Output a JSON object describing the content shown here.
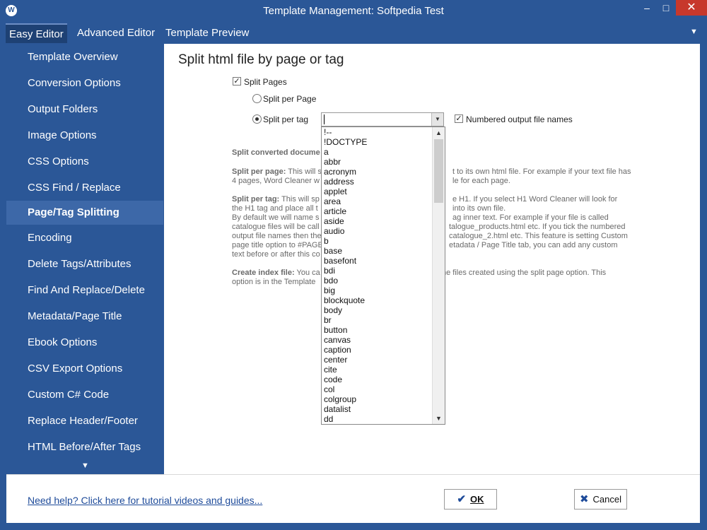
{
  "window": {
    "title": "Template Management: Softpedia Test",
    "app_icon": "W",
    "minimize_label": "–",
    "maximize_label": "□",
    "close_label": "✕"
  },
  "tabs": [
    {
      "label": "Easy Editor",
      "active": true
    },
    {
      "label": "Advanced Editor",
      "active": false
    },
    {
      "label": "Template Preview",
      "active": false
    }
  ],
  "tab_menu_arrow": "▼",
  "sidebar": {
    "items": [
      {
        "label": "Template Overview"
      },
      {
        "label": "Conversion Options"
      },
      {
        "label": "Output Folders"
      },
      {
        "label": "Image Options"
      },
      {
        "label": "CSS Options"
      },
      {
        "label": "CSS Find / Replace"
      },
      {
        "label": "Page/Tag Splitting",
        "selected": true
      },
      {
        "label": "Encoding"
      },
      {
        "label": "Delete Tags/Attributes"
      },
      {
        "label": "Find And Replace/Delete"
      },
      {
        "label": "Metadata/Page Title"
      },
      {
        "label": "Ebook Options"
      },
      {
        "label": "CSV Export Options"
      },
      {
        "label": "Custom C# Code"
      },
      {
        "label": "Replace Header/Footer"
      },
      {
        "label": "HTML Before/After Tags"
      }
    ],
    "scroll_down": "▼"
  },
  "main": {
    "title": "Split html file by page or tag",
    "split_pages": {
      "label": "Split Pages",
      "checked": true,
      "mark": "✓"
    },
    "split_per_page": {
      "label": "Split per Page",
      "selected": false
    },
    "split_per_tag": {
      "label": "Split per tag",
      "selected": true
    },
    "tag_combo_value": "",
    "combo_arrow": "▼",
    "numbered_names": {
      "label": "Numbered output file names",
      "checked": true,
      "mark": "✓"
    },
    "desc": {
      "heading": "Split converted docume",
      "per_page_bold": "Split per page:",
      "per_page_1a": " This will s",
      "per_page_1b": "t to its own html file. For example if your text file has",
      "per_page_2a": "4 pages, Word Cleaner w",
      "per_page_2b": "le for each page.",
      "per_tag_bold": "Split per tag:",
      "per_tag_1a": " This will sp",
      "per_tag_1b": "e H1. If you select H1 Word Cleaner will look for",
      "per_tag_2a": "the H1 tag and place all t",
      "per_tag_2b": "into its own file.",
      "per_tag_3a": "By default we will name s",
      "per_tag_3b": "ag inner text. For example if your file is called",
      "per_tag_4a": "catalogue files will be call",
      "per_tag_4b": "talogue_products.html etc. If you tick the numbered",
      "per_tag_5a": "output file names then the",
      "per_tag_5b": "catalogue_2.html etc. This feature is setting Custom",
      "per_tag_6a": "page title option to #PAGE",
      "per_tag_6b": "etadata / Page Title tab, you can add any custom",
      "per_tag_7a": "text before or after this co",
      "index_bold": "Create index file:",
      "index_1a": " You ca",
      "index_1b": "he files created using the split page option. This",
      "index_2a": "option is in the Template"
    },
    "tag_options": [
      "!--",
      "!DOCTYPE",
      "a",
      "abbr",
      "acronym",
      "address",
      "applet",
      "area",
      "article",
      "aside",
      "audio",
      "b",
      "base",
      "basefont",
      "bdi",
      "bdo",
      "big",
      "blockquote",
      "body",
      "br",
      "button",
      "canvas",
      "caption",
      "center",
      "cite",
      "code",
      "col",
      "colgroup",
      "datalist",
      "dd"
    ],
    "list_scroll_up": "▲",
    "list_scroll_down": "▼"
  },
  "footer": {
    "help_link": "Need help? Click here for tutorial videos and guides...",
    "ok_label": "OK",
    "ok_icon": "✔",
    "cancel_label": "Cancel",
    "cancel_icon": "✖"
  }
}
